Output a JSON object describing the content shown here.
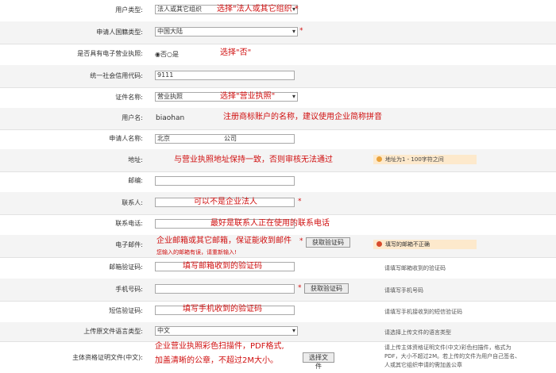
{
  "rows": [
    {
      "label": "用户类型:"
    },
    {
      "label": "申请人国籍类型:"
    },
    {
      "label": "是否具有电子营业执照:"
    },
    {
      "label": "统一社会信用代码:"
    },
    {
      "label": "证件名称:"
    },
    {
      "label": "用户名:"
    },
    {
      "label": "申请人名称:"
    },
    {
      "label": "地址:"
    },
    {
      "label": "邮编:"
    },
    {
      "label": "联系人:"
    },
    {
      "label": "联系电话:"
    },
    {
      "label": "电子邮件:"
    },
    {
      "label": "邮箱验证码:"
    },
    {
      "label": "手机号码:"
    },
    {
      "label": "短信验证码:"
    },
    {
      "label": "上传原文件语言类型:"
    },
    {
      "label": "主体资格证明文件(中文):"
    }
  ],
  "fields": {
    "user_type": "法人或其它组织",
    "nationality": "中国大陆",
    "ebiz_yes_no": "◉否○是",
    "credit_code": "9111",
    "cert_name": "营业执照",
    "username": "biaohan",
    "applicant_name_a": "北京",
    "applicant_name_b": "公司",
    "language": "中文",
    "email_hint": "您输入的邮箱有误，请重新输入!"
  },
  "buttons": {
    "email_code": "获取验证码",
    "sms_code": "获取验证码",
    "choose_file": "选择文件"
  },
  "annotations": {
    "a1": "选择\"法人或其它组织 *",
    "a3": "选择\"否\"",
    "a5": "选择\"营业执照\"",
    "a6": "注册商标账户的名称，建议使用企业简称拼音",
    "a8": "与营业执照地址保持一致，否则审核无法通过",
    "a10": "可以不是企业法人",
    "a11": "最好是联系人正在使用的联系电话",
    "a12": "企业邮箱或其它邮箱，保证能收到邮件",
    "a13": "填写邮箱收到的验证码",
    "a15": "填写手机收到的验证码",
    "a17a": "企业营业执照彩色扫描件，PDF格式,",
    "a17b": "加盖清晰的公章，不超过2M大小。"
  },
  "notes": {
    "address_tip": "地址为1 - 100字符之间",
    "email_tip": "填写的邮箱不正确",
    "email_code_tip": "请填写邮箱收到的验证码",
    "phone_tip": "请填写手机号码",
    "sms_tip": "请填写手机接收到的短信验证码",
    "lang_tip": "请选择上传文件的语言类型",
    "file_tip_1": "请上传主体资格证明文件(中文)彩色扫描件，格式为",
    "file_tip_2": "PDF，大小不超过2M。若上传的文件为用户自己签名、",
    "file_tip_3": "人或其它组织申请的需加盖公章"
  },
  "colors": {
    "annotation": "#d01010",
    "tip_bg": "#fde9cc",
    "tip_icon": "#e9a23b"
  }
}
